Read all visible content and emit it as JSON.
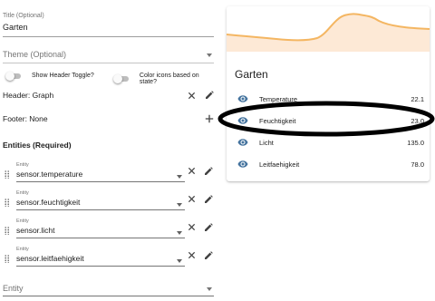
{
  "editor": {
    "title_field": {
      "label": "Title (Optional)",
      "value": "Garten"
    },
    "theme_field": {
      "placeholder": "Theme (Optional)"
    },
    "toggles": {
      "show_header": "Show Header Toggle?",
      "color_icons": "Color icons based on state?"
    },
    "header_row": "Header: Graph",
    "footer_row": "Footer: None",
    "entities_title": "Entities (Required)",
    "entity_label": "Entity",
    "entities": [
      "sensor.temperature",
      "sensor.feuchtigkeit",
      "sensor.licht",
      "sensor.leitfaehigkeit"
    ],
    "new_entity_placeholder": "Entity"
  },
  "preview": {
    "title": "Garten",
    "graph_color": "#f4b662",
    "graph_fill": "#fde9d6",
    "icon_color": "#44739e",
    "rows": [
      {
        "name": "Temperature",
        "value": "22.1"
      },
      {
        "name": "Feuchtigkeit",
        "value": "23.0"
      },
      {
        "name": "Licht",
        "value": "135.0"
      },
      {
        "name": "Leitfaehigkeit",
        "value": "78.0"
      }
    ]
  },
  "colors": {
    "annotation_ellipse": "#000000"
  }
}
